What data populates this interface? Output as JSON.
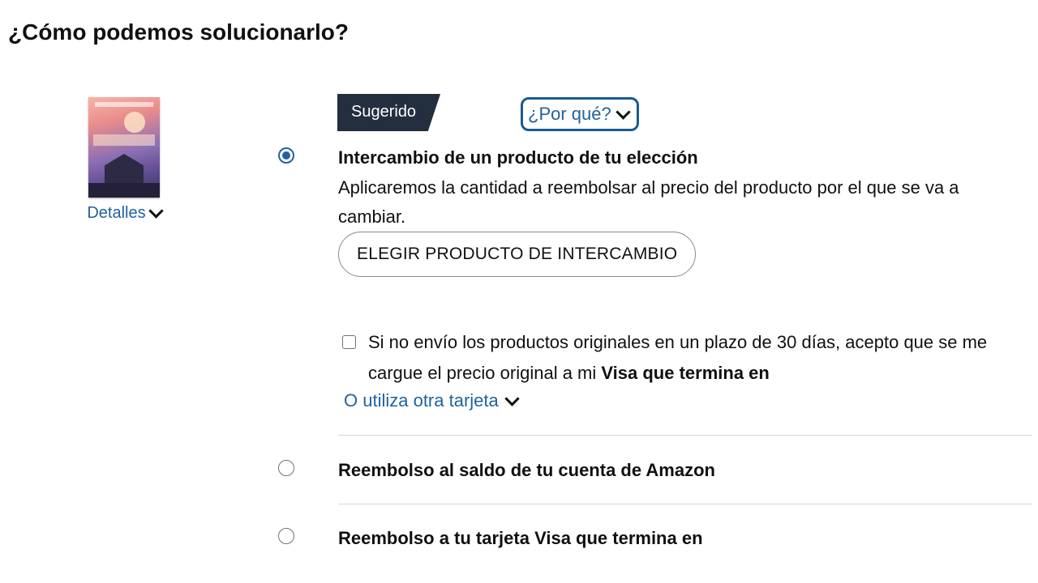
{
  "page_title": "¿Cómo podemos solucionarlo?",
  "product": {
    "details_label": "Detalles",
    "cover_icon": "book-cover-image"
  },
  "suggested": {
    "tag": "Sugerido",
    "why_label": "¿Por qué?"
  },
  "options": [
    {
      "title": "Intercambio de un producto de tu elección",
      "description": "Aplicaremos la cantidad a reembolsar al precio del producto por el que se va a cambiar.",
      "button_label": "ELEGIR PRODUCTO DE INTERCAMBIO",
      "selected": true
    },
    {
      "title": "Reembolso al saldo de tu cuenta de Amazon",
      "selected": false
    },
    {
      "title": "Reembolso a tu tarjeta Visa que termina en",
      "selected": false
    }
  ],
  "consent": {
    "text": "Si no envío los productos originales en un plazo de 30 días, acepto que se me cargue el precio original a mi",
    "card_text": "Visa que termina en",
    "checked": false
  },
  "other_card_label": "O utiliza otra tarjeta",
  "colors": {
    "link": "#2162a1",
    "tag_bg": "#232f3e",
    "radio_selected": "#2162a1",
    "divider": "#d5d9d9"
  }
}
